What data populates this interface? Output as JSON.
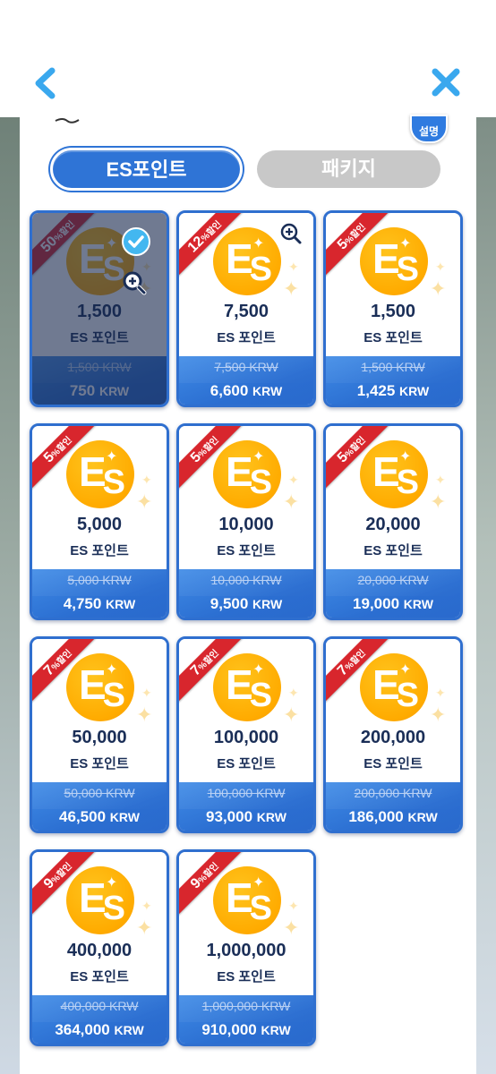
{
  "header": {
    "back_icon": "chevron-left-icon",
    "close_icon": "close-icon"
  },
  "help_badge": {
    "label": "설명"
  },
  "tabs": [
    {
      "label": "ES포인트",
      "active": true
    },
    {
      "label": "패키지",
      "active": false
    }
  ],
  "colors": {
    "accent": "#2f74d6",
    "ribbon": "#d8262d",
    "coin": "#ffab00",
    "text_dark": "#1a2e57"
  },
  "products": [
    {
      "badge_pct": "50",
      "badge_suffix": "%할인",
      "amount": "1,500",
      "unit_label": "ES 포인트",
      "original_price": "1,500 KRW",
      "final_price": "750",
      "currency": "KRW",
      "selected": true
    },
    {
      "badge_pct": "12",
      "badge_suffix": "%할인",
      "amount": "7,500",
      "unit_label": "ES 포인트",
      "original_price": "7,500 KRW",
      "final_price": "6,600",
      "currency": "KRW",
      "selected": false
    },
    {
      "badge_pct": "5",
      "badge_suffix": "%할인",
      "amount": "1,500",
      "unit_label": "ES 포인트",
      "original_price": "1,500 KRW",
      "final_price": "1,425",
      "currency": "KRW",
      "selected": false
    },
    {
      "badge_pct": "5",
      "badge_suffix": "%할인",
      "amount": "5,000",
      "unit_label": "ES 포인트",
      "original_price": "5,000 KRW",
      "final_price": "4,750",
      "currency": "KRW",
      "selected": false
    },
    {
      "badge_pct": "5",
      "badge_suffix": "%할인",
      "amount": "10,000",
      "unit_label": "ES 포인트",
      "original_price": "10,000 KRW",
      "final_price": "9,500",
      "currency": "KRW",
      "selected": false
    },
    {
      "badge_pct": "5",
      "badge_suffix": "%할인",
      "amount": "20,000",
      "unit_label": "ES 포인트",
      "original_price": "20,000 KRW",
      "final_price": "19,000",
      "currency": "KRW",
      "selected": false
    },
    {
      "badge_pct": "7",
      "badge_suffix": "%할인",
      "amount": "50,000",
      "unit_label": "ES 포인트",
      "original_price": "50,000 KRW",
      "final_price": "46,500",
      "currency": "KRW",
      "selected": false
    },
    {
      "badge_pct": "7",
      "badge_suffix": "%할인",
      "amount": "100,000",
      "unit_label": "ES 포인트",
      "original_price": "100,000 KRW",
      "final_price": "93,000",
      "currency": "KRW",
      "selected": false
    },
    {
      "badge_pct": "7",
      "badge_suffix": "%할인",
      "amount": "200,000",
      "unit_label": "ES 포인트",
      "original_price": "200,000 KRW",
      "final_price": "186,000",
      "currency": "KRW",
      "selected": false
    },
    {
      "badge_pct": "9",
      "badge_suffix": "%할인",
      "amount": "400,000",
      "unit_label": "ES 포인트",
      "original_price": "400,000 KRW",
      "final_price": "364,000",
      "currency": "KRW",
      "selected": false
    },
    {
      "badge_pct": "9",
      "badge_suffix": "%할인",
      "amount": "1,000,000",
      "unit_label": "ES 포인트",
      "original_price": "1,000,000 KRW",
      "final_price": "910,000",
      "currency": "KRW",
      "selected": false
    }
  ]
}
